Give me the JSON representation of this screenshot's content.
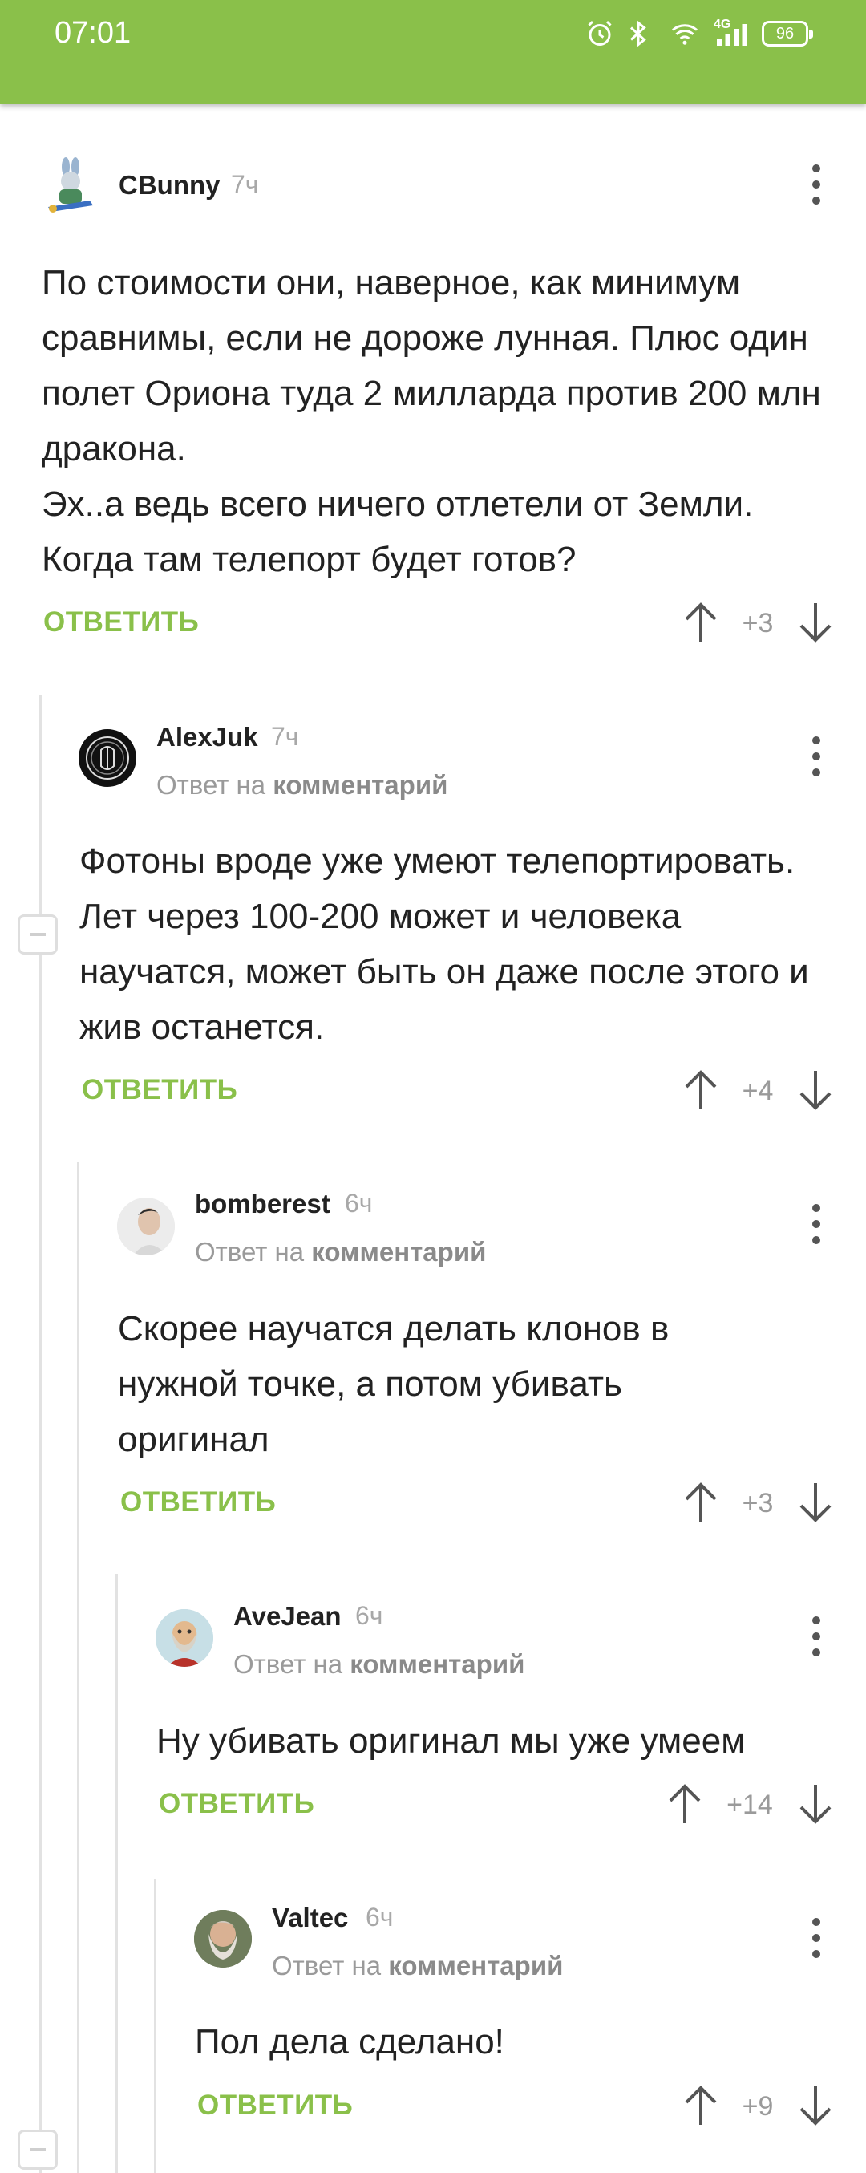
{
  "status_bar": {
    "time": "07:01",
    "battery": "96",
    "network": "4G",
    "icons": [
      "alarm-icon",
      "bluetooth-icon",
      "wifi-icon",
      "signal-icon",
      "battery-icon"
    ]
  },
  "comments": [
    {
      "username": "CBunny",
      "time": "7ч",
      "reply_prefix": "",
      "reply_target": "",
      "text": "По стоимости они, наверное, как минимум сравнимы, если не дороже лунная. Плюс один полет Ориона туда 2 милларда против 200 млн дракона.\nЭх..а ведь всего ничего отлетели от Земли. Когда там телепорт будет готов?",
      "reply_label": "ОТВЕТИТЬ",
      "score": "+3"
    },
    {
      "username": "AlexJuk",
      "time": "7ч",
      "reply_prefix": "Ответ на",
      "reply_target": "комментарий",
      "text": "Фотоны вроде уже умеют телепортировать. Лет через 100-200 может и человека научатся, может быть он даже после этого и жив останется.",
      "reply_label": "ОТВЕТИТЬ",
      "score": "+4"
    },
    {
      "username": "bomberest",
      "time": "6ч",
      "reply_prefix": "Ответ на",
      "reply_target": "комментарий",
      "text": "Скорее научатся делать клонов в нужной точке, а потом убивать оригинал",
      "reply_label": "ОТВЕТИТЬ",
      "score": "+3"
    },
    {
      "username": "AveJean",
      "time": "6ч",
      "reply_prefix": "Ответ на",
      "reply_target": "комментарий",
      "text": "Ну убивать оригинал мы уже умеем",
      "reply_label": "ОТВЕТИТЬ",
      "score": "+14"
    },
    {
      "username": "Valtec",
      "time": "6ч",
      "reply_prefix": "Ответ на",
      "reply_target": "комментарий",
      "text": "Пол дела сделано!",
      "reply_label": "ОТВЕТИТЬ",
      "score": "+9"
    }
  ],
  "colors": {
    "accent": "#8ac04a",
    "thread_line": "#e2e2e2",
    "meta_text": "#9a9a9a"
  }
}
